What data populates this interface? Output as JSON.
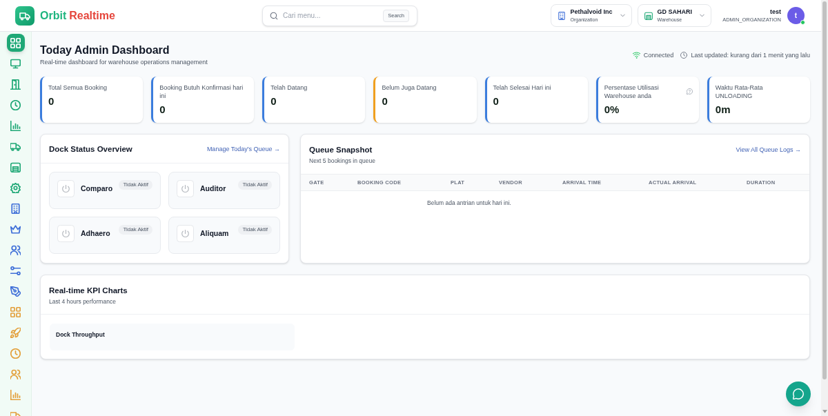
{
  "header": {
    "brand": [
      {
        "text": "Orbit",
        "color": "#1fb57f"
      },
      {
        "text": "Realtime",
        "color": "#e5453b"
      }
    ],
    "search": {
      "placeholder": "Cari menu...",
      "button": "Search"
    },
    "organization": {
      "name": "Pethalvoid Inc",
      "caption": "Organization"
    },
    "warehouse": {
      "name": "GD SAHARI",
      "caption": "Warehouse"
    },
    "user": {
      "name": "test",
      "role": "ADMIN_ORGANIZATION",
      "initial": "t",
      "online": true
    }
  },
  "sidebar": {
    "groups": [
      {
        "color": "#1fa876",
        "items": [
          {
            "selected": true
          },
          {
            "selected": false
          },
          {
            "selected": false
          },
          {
            "selected": false
          },
          {
            "selected": false
          },
          {
            "selected": false
          },
          {
            "selected": false
          },
          {
            "selected": false
          }
        ]
      },
      {
        "color": "#3f6fd8",
        "items": [
          {
            "selected": false
          },
          {
            "selected": false
          },
          {
            "selected": false
          },
          {
            "selected": false
          },
          {
            "selected": false
          }
        ]
      },
      {
        "color": "#e3a03c",
        "items": [
          {
            "selected": false
          },
          {
            "selected": false
          },
          {
            "selected": false
          },
          {
            "selected": false
          },
          {
            "selected": false
          },
          {
            "selected": false
          }
        ]
      }
    ]
  },
  "page": {
    "title": "Today Admin Dashboard",
    "subtitle": "Real-time dashboard for warehouse operations management",
    "connection": {
      "connected": true,
      "label": "Connected"
    },
    "last_updated": "Last updated: kurang dari 1 menit yang lalu"
  },
  "stats": [
    {
      "label": "Total Semua Booking",
      "value": "0",
      "color": "#3b7ddd",
      "kind": "plain"
    },
    {
      "label": "Booking Butuh Konfirmasi hari ini",
      "value": "0",
      "color": "#3b7ddd",
      "kind": "plain"
    },
    {
      "label": "Telah Datang",
      "value": "0",
      "color": "#3b7ddd",
      "kind": "plain"
    },
    {
      "label": "Belum Juga Datang",
      "value": "0",
      "color": "#f0a020",
      "kind": "plain"
    },
    {
      "label": "Telah Selesai Hari ini",
      "value": "0",
      "color": "#3b7ddd",
      "kind": "plain"
    },
    {
      "label": "Persentase Utilisasi Warehouse anda",
      "value": "0%",
      "color": "#3b7ddd",
      "kind": "help"
    },
    {
      "label": "Waktu Rata-Rata UNLOADING",
      "value": "0m",
      "color": "#3b7ddd",
      "kind": "plain"
    }
  ],
  "dock_status": {
    "title": "Dock Status Overview",
    "link": "Manage Today's Queue →",
    "docks": [
      {
        "name": "Comparo",
        "status": "Tidak Aktif",
        "active": false
      },
      {
        "name": "Auditor",
        "status": "Tidak Aktif",
        "active": false
      },
      {
        "name": "Adhaero",
        "status": "Tidak Aktif",
        "active": false
      },
      {
        "name": "Aliquam",
        "status": "Tidak Aktif",
        "active": false
      }
    ]
  },
  "queue_snapshot": {
    "title": "Queue Snapshot",
    "subtitle": "Next 5 bookings in queue",
    "link": "View All Queue Logs →",
    "columns": [
      "GATE",
      "BOOKING CODE",
      "PLAT",
      "VENDOR",
      "ARRIVAL TIME",
      "ACTUAL ARRIVAL",
      "DURATION"
    ],
    "empty_message": "Belum ada antrian untuk hari ini."
  },
  "kpi_charts": {
    "title": "Real-time KPI Charts",
    "subtitle": "Last 4 hours performance",
    "charts": [
      {
        "title": "Dock Throughput"
      }
    ]
  }
}
